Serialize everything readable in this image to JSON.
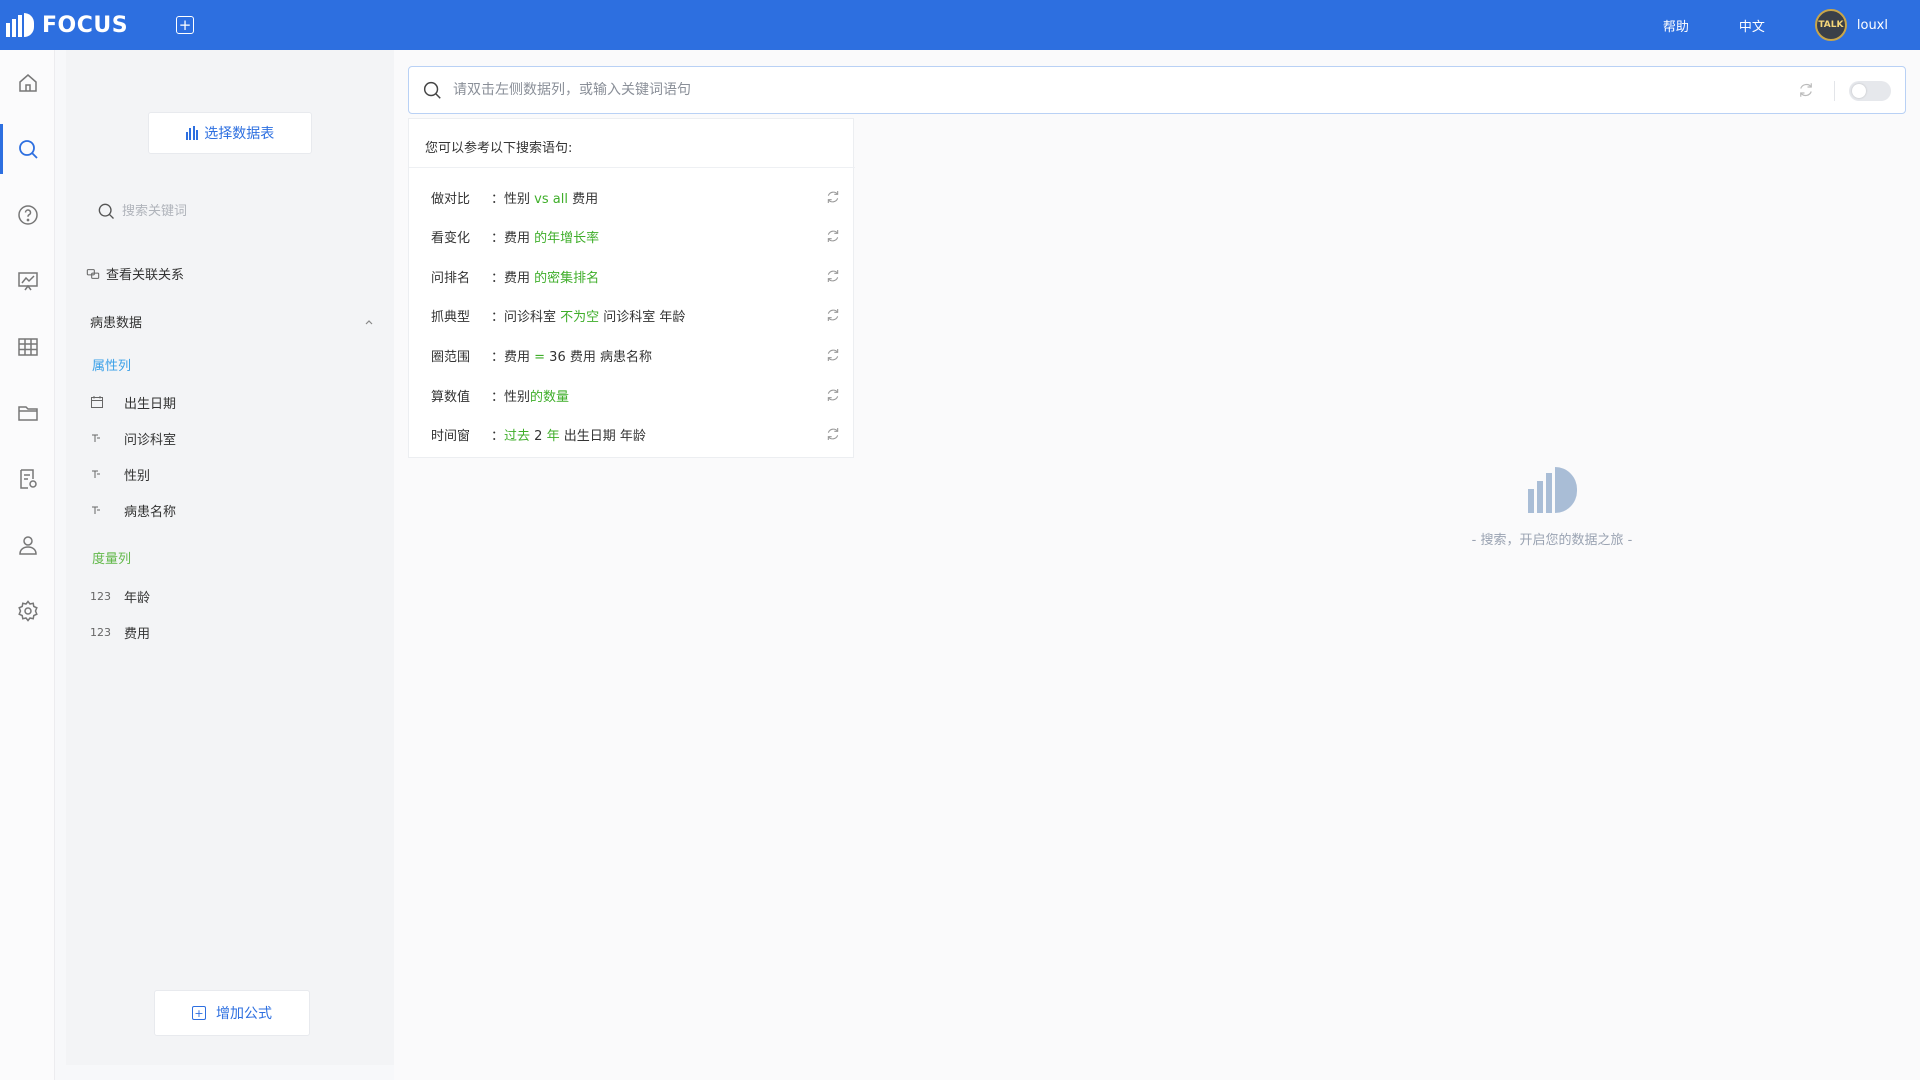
{
  "app": {
    "name": "FOCUS",
    "add_tab_symbol": "+"
  },
  "topbar": {
    "help": "帮助",
    "language": "中文",
    "username": "louxl"
  },
  "rail": {
    "items": [
      "home-icon",
      "search-icon",
      "help-icon",
      "chart-board-icon",
      "table-icon",
      "folder-icon",
      "report-settings-icon",
      "user-icon",
      "settings-icon"
    ],
    "active_index": 1
  },
  "panel": {
    "select_table": "选择数据表",
    "search_placeholder": "搜索关键词",
    "relation": "查看关联关系",
    "group": "病患数据",
    "attr_section": "属性列",
    "attr_fields": [
      {
        "icon": "calendar-icon",
        "name": "出生日期"
      },
      {
        "icon": "text-type-icon",
        "name": "问诊科室"
      },
      {
        "icon": "text-type-icon",
        "name": "性别"
      },
      {
        "icon": "text-type-icon",
        "name": "病患名称"
      }
    ],
    "measure_section": "度量列",
    "measure_fields": [
      {
        "icon": "123",
        "name": "年龄"
      },
      {
        "icon": "123",
        "name": "费用"
      }
    ],
    "add_formula": "增加公式"
  },
  "search": {
    "placeholder": "请双击左侧数据列，或输入关键词语句"
  },
  "suggest": {
    "title": "您可以参考以下搜索语句:",
    "rows": [
      {
        "cat": "做对比",
        "parts": [
          [
            "n",
            "：性别 "
          ],
          [
            "g",
            "vs all"
          ],
          [
            "n",
            " 费用"
          ]
        ]
      },
      {
        "cat": "看变化",
        "parts": [
          [
            "n",
            "：费用 "
          ],
          [
            "g",
            "的年增长率"
          ]
        ]
      },
      {
        "cat": "问排名",
        "parts": [
          [
            "n",
            "：费用 "
          ],
          [
            "g",
            "的密集排名"
          ]
        ]
      },
      {
        "cat": "抓典型",
        "parts": [
          [
            "n",
            "：问诊科室 "
          ],
          [
            "g",
            "不为空"
          ],
          [
            "n",
            " 问诊科室 年龄"
          ]
        ]
      },
      {
        "cat": "圈范围",
        "parts": [
          [
            "n",
            "：费用 "
          ],
          [
            "g",
            "="
          ],
          [
            "n",
            " 36 费用 病患名称"
          ]
        ]
      },
      {
        "cat": "算数值",
        "parts": [
          [
            "n",
            "：性别"
          ],
          [
            "g",
            "的数量"
          ]
        ]
      },
      {
        "cat": "时间窗",
        "parts": [
          [
            "n",
            "："
          ],
          [
            "g",
            "过去"
          ],
          [
            "n",
            " 2 "
          ],
          [
            "g",
            "年"
          ],
          [
            "n",
            " 出生日期 年龄"
          ]
        ]
      }
    ]
  },
  "empty_state": {
    "text": "- 搜索，开启您的数据之旅 -"
  },
  "colors": {
    "brand": "#2d6fe0",
    "attr": "#3aa0e8",
    "measure": "#62b84a",
    "keyword": "#3fae2a"
  }
}
